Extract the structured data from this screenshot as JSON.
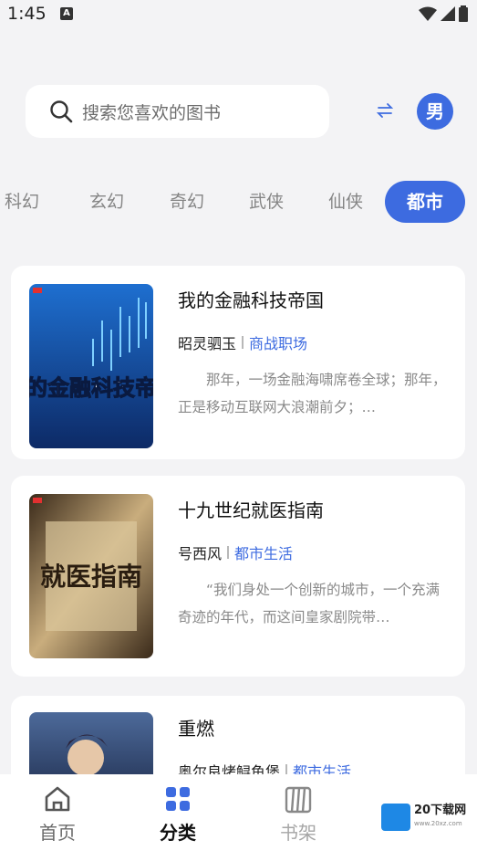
{
  "status_bar": {
    "time": "1:45",
    "notif_icon": "A"
  },
  "search": {
    "placeholder": "搜索您喜欢的图书",
    "gender": "男"
  },
  "tabs": [
    {
      "label": "科幻"
    },
    {
      "label": "玄幻"
    },
    {
      "label": "奇幻"
    },
    {
      "label": "武侠"
    },
    {
      "label": "仙侠"
    },
    {
      "label": "都市",
      "active": true
    }
  ],
  "books": [
    {
      "title": "我的金融科技帝国",
      "author": "昭灵驷玉",
      "genre": "商战职场",
      "desc": "那年，一场金融海啸席卷全球；那年，正是移动互联网大浪潮前夕；…",
      "cover_text": "我的金融科技帝国",
      "cover_colors": [
        "#0d2a66",
        "#1e6fd0"
      ]
    },
    {
      "title": "十九世纪就医指南",
      "author": "号西风",
      "genre": "都市生活",
      "desc": "“我们身处一个创新的城市，一个充满奇迹的年代，而这间皇家剧院带…",
      "cover_text": "就医指南",
      "cover_colors": [
        "#3a2a1a",
        "#c9ad7d"
      ]
    },
    {
      "title": "重燃",
      "author": "奥尔良烤鲟鱼堡",
      "genre": "都市生活",
      "desc": "",
      "cover_text": "",
      "cover_colors": [
        "#15203d",
        "#4d6a9a"
      ]
    }
  ],
  "nav": {
    "home": "首页",
    "category": "分类",
    "shelf": "书架"
  },
  "watermark": {
    "brand": "20下载网",
    "url": "www.20xz.com"
  },
  "colors": {
    "accent": "#3d6be0",
    "background": "#f3f3f5"
  }
}
